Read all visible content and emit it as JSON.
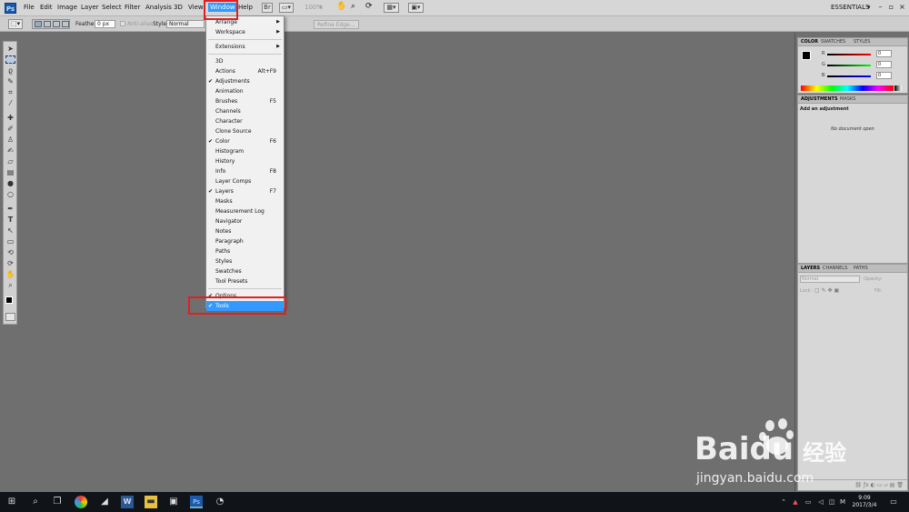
{
  "menubar": {
    "logo": "Ps",
    "items": [
      "File",
      "Edit",
      "Image",
      "Layer",
      "Select",
      "Filter",
      "Analysis",
      "3D",
      "View",
      "Window",
      "Help"
    ],
    "zoom": "100%",
    "workspace": "ESSENTIALS"
  },
  "options": {
    "feather_label": "Feather:",
    "feather_value": "0 px",
    "antialias_label": "Anti-alias",
    "style_label": "Style:",
    "style_value": "Normal",
    "refine_edge": "Refine Edge..."
  },
  "window_menu": {
    "items": [
      {
        "label": "Arrange",
        "submenu": true
      },
      {
        "label": "Workspace",
        "submenu": true
      },
      {
        "label": "Extensions",
        "submenu": true
      },
      {
        "label": "3D"
      },
      {
        "label": "Actions",
        "shortcut": "Alt+F9"
      },
      {
        "label": "Adjustments",
        "checked": true
      },
      {
        "label": "Animation"
      },
      {
        "label": "Brushes",
        "shortcut": "F5"
      },
      {
        "label": "Channels"
      },
      {
        "label": "Character"
      },
      {
        "label": "Clone Source"
      },
      {
        "label": "Color",
        "checked": true,
        "shortcut": "F6"
      },
      {
        "label": "Histogram"
      },
      {
        "label": "History"
      },
      {
        "label": "Info",
        "shortcut": "F8"
      },
      {
        "label": "Layer Comps"
      },
      {
        "label": "Layers",
        "checked": true,
        "shortcut": "F7"
      },
      {
        "label": "Masks"
      },
      {
        "label": "Measurement Log"
      },
      {
        "label": "Navigator"
      },
      {
        "label": "Notes"
      },
      {
        "label": "Paragraph"
      },
      {
        "label": "Paths"
      },
      {
        "label": "Styles"
      },
      {
        "label": "Swatches"
      },
      {
        "label": "Tool Presets"
      },
      {
        "label": "Options",
        "checked": true
      },
      {
        "label": "Tools",
        "checked": true,
        "highlighted": true
      }
    ]
  },
  "color_panel": {
    "tabs": [
      "COLOR",
      "SWATCHES",
      "STYLES"
    ],
    "channels": [
      {
        "label": "R",
        "value": "0",
        "color": "#d02020"
      },
      {
        "label": "G",
        "value": "0",
        "color": "#20a020"
      },
      {
        "label": "B",
        "value": "0",
        "color": "#2040d0"
      }
    ]
  },
  "adjustments_panel": {
    "tabs": [
      "ADJUSTMENTS",
      "MASKS"
    ],
    "heading": "Add an adjustment",
    "empty": "No document open"
  },
  "layers_panel": {
    "tabs": [
      "LAYERS",
      "CHANNELS",
      "PATHS"
    ],
    "blend": "Normal",
    "opacity_label": "Opacity:",
    "lock_label": "Lock:",
    "fill_label": "Fill:"
  },
  "taskbar": {
    "time": "9:09",
    "date": "2017/3/4",
    "ime": "M"
  },
  "watermark": {
    "brand": "Baidu",
    "cn": "经验",
    "url": "jingyan.baidu.com"
  }
}
